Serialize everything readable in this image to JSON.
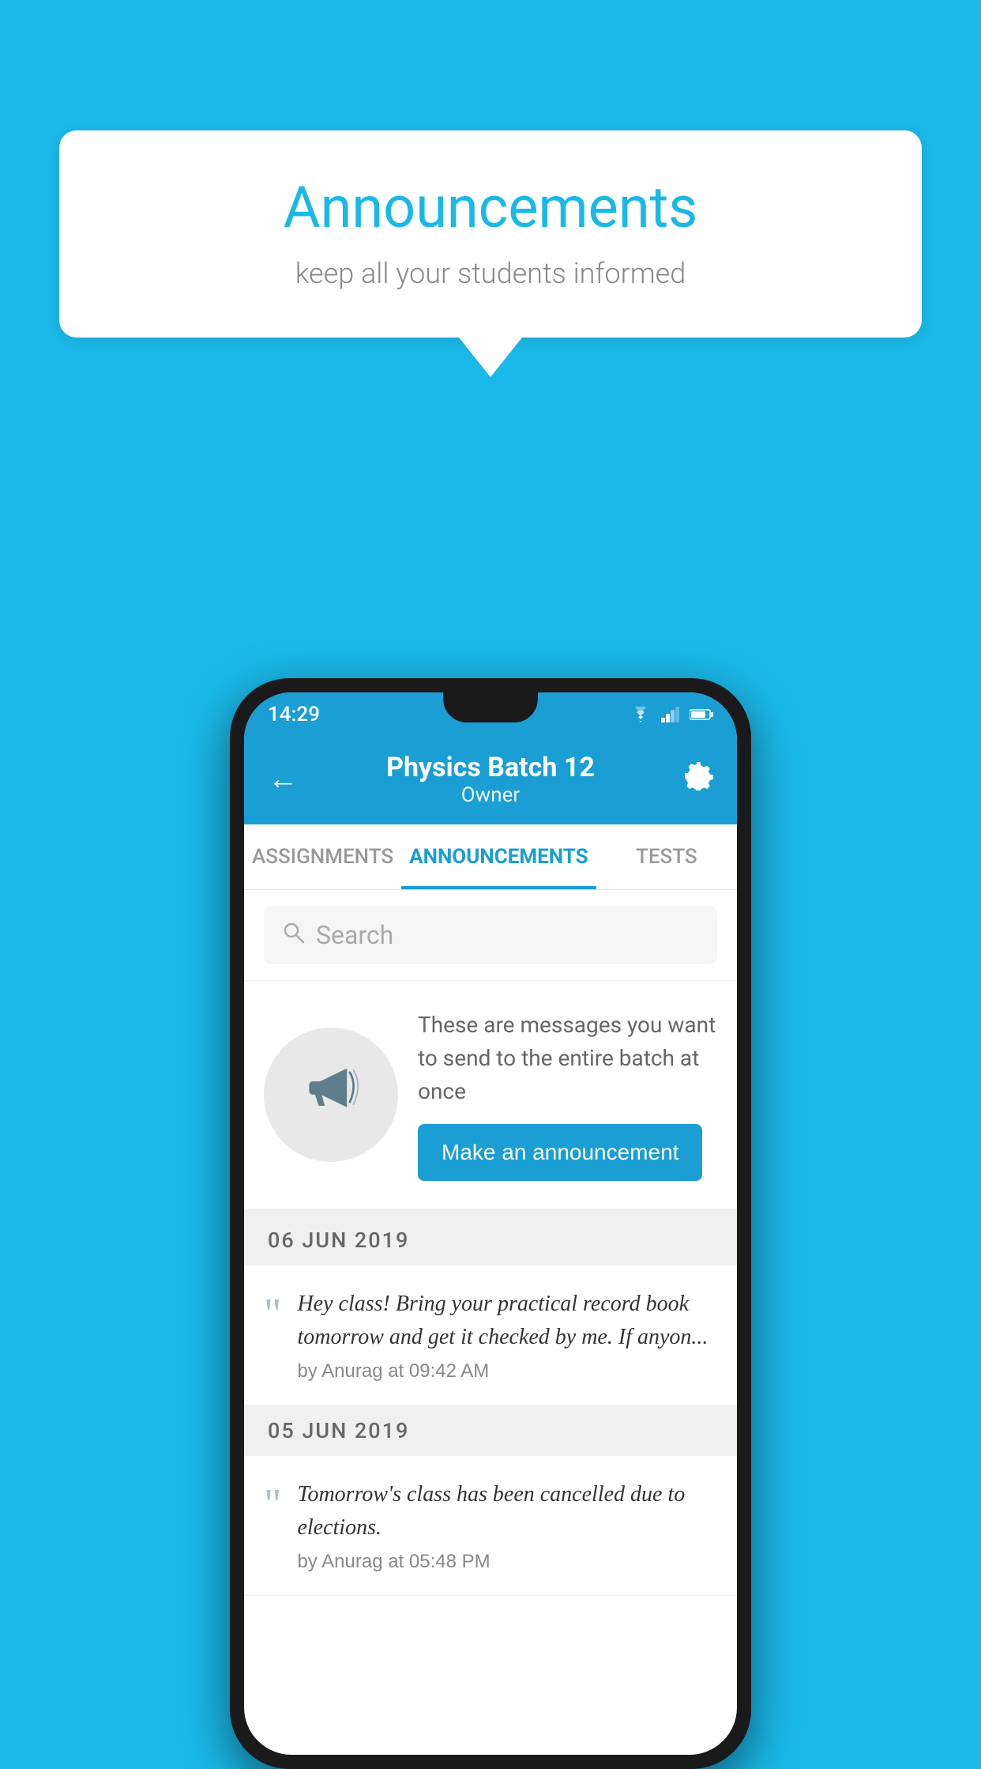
{
  "bubble": {
    "title": "Announcements",
    "subtitle": "keep all your students informed"
  },
  "status_bar": {
    "time": "14:29"
  },
  "header": {
    "title": "Physics Batch 12",
    "subtitle": "Owner"
  },
  "tabs": [
    {
      "label": "ASSIGNMENTS",
      "active": false
    },
    {
      "label": "ANNOUNCEMENTS",
      "active": true
    },
    {
      "label": "TESTS",
      "active": false
    }
  ],
  "search": {
    "placeholder": "Search"
  },
  "prompt": {
    "text": "These are messages you want to send to the entire batch at once",
    "button_label": "Make an announcement"
  },
  "dates": [
    {
      "label": "06  JUN  2019",
      "messages": [
        {
          "text": "Hey class! Bring your practical record book tomorrow and get it checked by me. If anyon...",
          "author": "by Anurag at 09:42 AM"
        }
      ]
    },
    {
      "label": "05  JUN  2019",
      "messages": [
        {
          "text": "Tomorrow's class has been cancelled due to elections.",
          "author": "by Anurag at 05:48 PM"
        }
      ]
    }
  ],
  "colors": {
    "accent": "#1a9ed4",
    "background": "#1ab8e8"
  }
}
